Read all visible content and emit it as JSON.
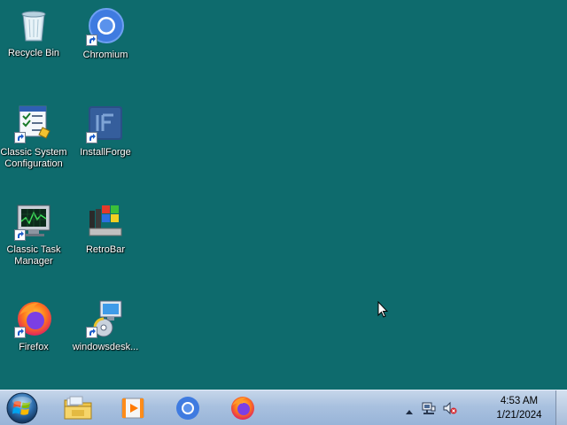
{
  "desktop": {
    "icons": [
      {
        "label": "Recycle Bin"
      },
      {
        "label": "Chromium"
      },
      {
        "label": "Classic System Configuration"
      },
      {
        "label": "InstallForge"
      },
      {
        "label": "Classic Task Manager"
      },
      {
        "label": "RetroBar"
      },
      {
        "label": "Firefox"
      },
      {
        "label": "windowsdesk..."
      }
    ]
  },
  "taskbar": {
    "pinned": [
      "explorer-icon",
      "media-player-icon",
      "chromium-icon",
      "firefox-icon"
    ],
    "tray": {
      "time": "4:53 AM",
      "date": "1/21/2024"
    }
  },
  "colors": {
    "desktop_background": "#0e6b6d",
    "taskbar_top": "#c6d6ea",
    "taskbar_bottom": "#98b4d8"
  }
}
